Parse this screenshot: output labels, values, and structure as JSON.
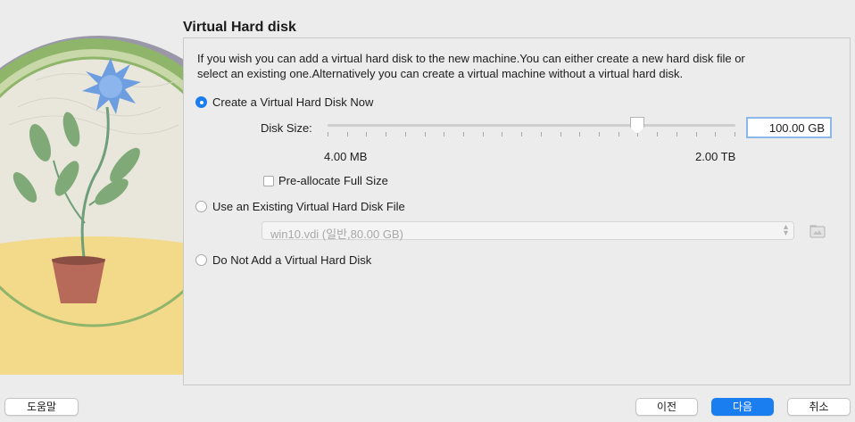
{
  "wizard": {
    "title": "Virtual Hard disk",
    "description": "If you wish you can add a virtual hard disk to the new machine.You can either create a new hard disk file or select an existing one.Alternatively you can create a virtual machine without a virtual hard disk."
  },
  "options": {
    "create_now": {
      "label": "Create a Virtual Hard Disk Now",
      "selected": true
    },
    "use_existing": {
      "label": "Use an Existing Virtual Hard Disk File",
      "selected": false
    },
    "do_not_add": {
      "label": "Do Not Add a Virtual Hard Disk",
      "selected": false
    }
  },
  "disk_size": {
    "label": "Disk Size:",
    "value": "100.00 GB",
    "min_label": "4.00 MB",
    "max_label": "2.00 TB",
    "slider_fraction": 0.76
  },
  "preallocate": {
    "label": "Pre-allocate Full Size",
    "checked": false
  },
  "existing_file": {
    "selected": "win10.vdi (일반,80.00 GB)"
  },
  "buttons": {
    "help": "도움말",
    "back": "이전",
    "next": "다음",
    "cancel": "취소"
  },
  "colors": {
    "accent": "#1a7df0",
    "background": "#ececec"
  },
  "icons": {
    "folder": "folder-open-icon",
    "select_arrows": "chevron-up-down-icon"
  }
}
